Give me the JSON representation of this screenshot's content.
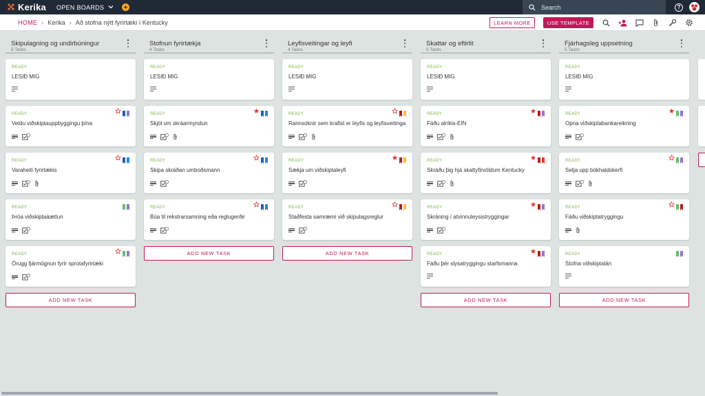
{
  "app": {
    "logo": "Kerika",
    "open_boards": "OPEN BOARDS",
    "search_label": "Search"
  },
  "colors": {
    "topbar": "#1f2a36",
    "accent": "#c2185b",
    "ready": "#7cb342"
  },
  "breadcrumb": {
    "home": "HOME",
    "items": [
      "Kerika",
      "Að stofna nýtt fyrirtæki í Kentucky"
    ]
  },
  "toolbar": {
    "learn_more": "LEARN MORE",
    "use_template": "USE TEMPLATE",
    "icons": [
      "search-icon",
      "add-person-icon",
      "chat-icon",
      "attachment-icon",
      "wrench-icon",
      "settings-icon"
    ]
  },
  "add_task_label": "ADD NEW TASK",
  "columns": [
    {
      "title": "Skipulagning og undirbúningur",
      "count": "5 Tasks",
      "cards": [
        {
          "status": "READY",
          "title": "LESIÐ MIG",
          "icons": [
            "desc"
          ],
          "flags": []
        },
        {
          "status": "READY",
          "title": "Veldu viðskiptauppbyggingu þína",
          "icons": [
            "desc",
            "check"
          ],
          "check": "2",
          "flags": [
            "star-outline",
            "blue",
            "purple"
          ]
        },
        {
          "status": "READY",
          "title": "Varaheiti fyrirtækis",
          "icons": [
            "desc",
            "check",
            "clip"
          ],
          "check": "3",
          "flags": [
            "star-outline",
            "blue",
            "blue2"
          ]
        },
        {
          "status": "READY",
          "title": "Þróa viðskiptaáætlun",
          "icons": [
            "desc",
            "check"
          ],
          "check": "2",
          "flags": [
            "green",
            "purple"
          ]
        },
        {
          "status": "READY",
          "title": "Örugg fjármögnun fyrir sprotafyrirtæki",
          "icons": [
            "desc",
            "check"
          ],
          "check": "2",
          "flags": [
            "star-outline",
            "green",
            "purple"
          ]
        }
      ]
    },
    {
      "title": "Stofnun fyrirtækja",
      "count": "4 Tasks",
      "cards": [
        {
          "status": "READY",
          "title": "LESIÐ MIG",
          "icons": [
            "desc"
          ],
          "flags": []
        },
        {
          "status": "READY",
          "title": "Skjöl um skráarmyndun",
          "icons": [
            "desc",
            "check",
            "clip"
          ],
          "check": "2",
          "flags": [
            "star-filled",
            "blue",
            "blue2"
          ]
        },
        {
          "status": "READY",
          "title": "Skipa skráðan umboðsmann",
          "icons": [
            "desc",
            "check"
          ],
          "check": "1",
          "flags": [
            "star-outline",
            "blue",
            "blue2"
          ]
        },
        {
          "status": "READY",
          "title": "Búa til rekstrarsamning eða reglugerðir",
          "icons": [
            "desc",
            "check"
          ],
          "check": "2",
          "flags": [
            "star-outline",
            "blue",
            "blue2"
          ]
        }
      ]
    },
    {
      "title": "Leyfisveitingar og leyfi",
      "count": "4 Tasks",
      "cards": [
        {
          "status": "READY",
          "title": "LESIÐ MIG",
          "icons": [
            "desc"
          ],
          "flags": []
        },
        {
          "status": "READY",
          "title": "Rannsóknir sem krafist er leyfis og leyfisveitinga",
          "icons": [
            "desc",
            "check",
            "clip"
          ],
          "check": "2",
          "flags": [
            "star-outline",
            "darkred",
            "yellow"
          ]
        },
        {
          "status": "READY",
          "title": "Sækja um viðskiptaleyfi",
          "icons": [
            "desc",
            "check"
          ],
          "check": "2",
          "flags": [
            "star-filled",
            "darkred",
            "yellow"
          ]
        },
        {
          "status": "READY",
          "title": "Staðfesta samræmi við skipulagsreglur",
          "icons": [
            "desc",
            "check"
          ],
          "check": "2",
          "flags": [
            "star-outline",
            "darkred",
            "yellow"
          ]
        }
      ]
    },
    {
      "title": "Skattar og eftirlit",
      "count": "5 Tasks",
      "cards": [
        {
          "status": "READY",
          "title": "LESIÐ MIG",
          "icons": [
            "desc"
          ],
          "flags": []
        },
        {
          "status": "READY",
          "title": "Fáðu alríkis-EIN",
          "icons": [
            "desc",
            "check",
            "clip"
          ],
          "check": "2",
          "flags": [
            "star-filled",
            "darkred",
            "purple"
          ]
        },
        {
          "status": "READY",
          "title": "Skráðu þig hjá skattyfirvöldum Kentucky",
          "icons": [
            "desc",
            "check",
            "clip"
          ],
          "check": "2",
          "flags": [
            "star-filled",
            "darkred",
            "red"
          ]
        },
        {
          "status": "READY",
          "title": "Skráning í atvinnuleysistryggingar",
          "icons": [
            "desc",
            "check"
          ],
          "check": "2",
          "flags": [
            "star-filled",
            "darkred",
            "purple"
          ]
        },
        {
          "status": "READY",
          "title": "Fáðu þér slysatryggingu starfsmanna",
          "icons": [
            "desc"
          ],
          "flags": [
            "star-filled",
            "darkred",
            "purple"
          ]
        }
      ]
    },
    {
      "title": "Fjárhagsleg uppsetning",
      "count": "5 Tasks",
      "cards": [
        {
          "status": "READY",
          "title": "LESIÐ MIG",
          "icons": [
            "desc"
          ],
          "flags": []
        },
        {
          "status": "READY",
          "title": "Opna viðskiptabankareikning",
          "icons": [
            "desc",
            "check"
          ],
          "check": "2",
          "flags": [
            "star-filled",
            "green",
            "purple"
          ]
        },
        {
          "status": "READY",
          "title": "Setja upp bókhaldskerfi",
          "icons": [
            "desc",
            "check",
            "clip"
          ],
          "check": "2",
          "flags": [
            "star-outline",
            "green",
            "purple"
          ]
        },
        {
          "status": "READY",
          "title": "Fáðu viðskiptatryggingu",
          "icons": [
            "desc",
            "clip"
          ],
          "flags": [
            "star-outline",
            "green",
            "darkred"
          ]
        },
        {
          "status": "READY",
          "title": "Stofna viðskiptalán",
          "icons": [
            "desc"
          ],
          "flags": [
            "green",
            "purple"
          ]
        }
      ]
    }
  ]
}
